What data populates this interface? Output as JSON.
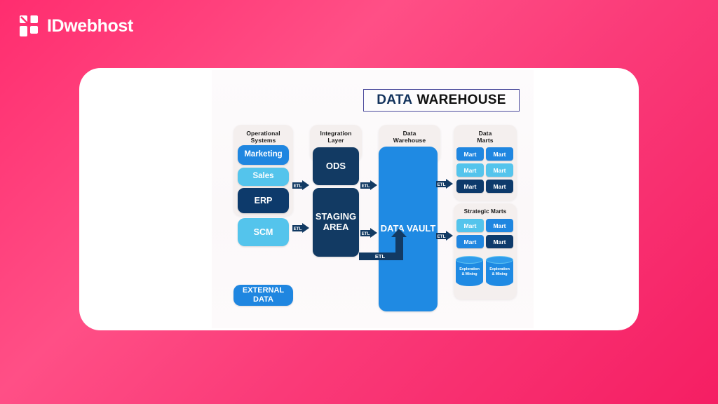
{
  "brand": {
    "name": "IDwebhost",
    "logo_icon": "idwebhost-blocks-icon",
    "color": "#ffffff"
  },
  "background": {
    "gradient_from": "#ff2d6f",
    "gradient_to": "#f51e63"
  },
  "card": {
    "background": "#ffffff"
  },
  "diagram": {
    "title": {
      "part1": "DATA",
      "part2": "WAREHOUSE",
      "part1_color": "#12325c",
      "part2_color": "#111111",
      "border_color": "#4a4a9c"
    },
    "colors": {
      "medium_blue": "#1f86e0",
      "light_blue": "#54c4ec",
      "dark_navy": "#0d3a6b",
      "vault_blue": "#1f8ae3",
      "panel": "#f4efee",
      "arrow": "#123a63"
    },
    "columns": [
      {
        "id": "operational-systems",
        "heading": "Operational\nSystems",
        "heading_line1": "Operational",
        "heading_line2": "Systems",
        "boxes": [
          {
            "label": "Marketing",
            "color": "medium_blue"
          },
          {
            "label": "Sales",
            "color": "light_blue"
          },
          {
            "label": "ERP",
            "color": "dark_navy"
          },
          {
            "label": "SCM",
            "color": "light_blue"
          }
        ]
      },
      {
        "id": "integration-layer",
        "heading_line1": "Integration",
        "heading_line2": "Layer",
        "boxes": [
          {
            "label": "ODS",
            "color": "dark_navy"
          },
          {
            "label": "STAGING AREA",
            "label_line1": "STAGING",
            "label_line2": "AREA",
            "color": "dark_navy"
          }
        ]
      },
      {
        "id": "data-warehouse",
        "heading_line1": "Data",
        "heading_line2": "Warehouse",
        "boxes": [
          {
            "label": "DATA VAULT",
            "color": "vault_blue"
          }
        ]
      },
      {
        "id": "data-marts",
        "heading_line1": "Data",
        "heading_line2": "Marts",
        "marts": [
          {
            "label": "Mart",
            "color": "medium_blue"
          },
          {
            "label": "Mart",
            "color": "medium_blue"
          },
          {
            "label": "Mart",
            "color": "light_blue"
          },
          {
            "label": "Mart",
            "color": "light_blue"
          },
          {
            "label": "Mart",
            "color": "dark_navy"
          },
          {
            "label": "Mart",
            "color": "dark_navy"
          }
        ]
      },
      {
        "id": "strategic-marts",
        "heading_line1": "Strategic Marts",
        "marts": [
          {
            "label": "Mart",
            "color": "light_blue"
          },
          {
            "label": "Mart",
            "color": "medium_blue"
          },
          {
            "label": "Mart",
            "color": "medium_blue"
          },
          {
            "label": "Mart",
            "color": "dark_navy"
          }
        ],
        "cylinders": [
          {
            "label_line1": "Exploration",
            "label_line2": "& Mining"
          },
          {
            "label_line1": "Exploration",
            "label_line2": "& Mining"
          }
        ]
      }
    ],
    "external_data": {
      "label": "EXTERNAL DATA",
      "color": "medium_blue",
      "arrow_label": "ETL"
    },
    "etl_arrows": [
      {
        "id": "etl-ops-to-ods",
        "label": "ETL"
      },
      {
        "id": "etl-ops-to-staging",
        "label": "ETL"
      },
      {
        "id": "etl-ods-to-vault",
        "label": "ETL"
      },
      {
        "id": "etl-staging-to-vault",
        "label": "ETL"
      },
      {
        "id": "etl-vault-to-marts",
        "label": "ETL"
      },
      {
        "id": "etl-vault-to-strategic",
        "label": "ETL"
      }
    ]
  }
}
